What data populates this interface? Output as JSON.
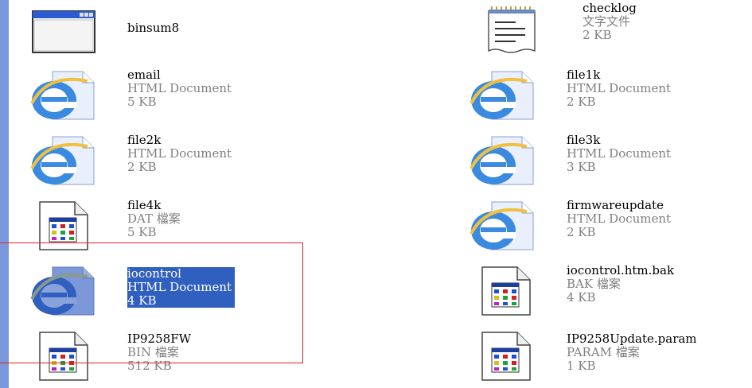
{
  "files": [
    {
      "name": "binsum8",
      "type": "",
      "size": "",
      "icon": "window-app-icon",
      "col": "left"
    },
    {
      "name": "checklog",
      "type": "文字文件",
      "size": "2 KB",
      "icon": "notepad-text-icon",
      "col": "right"
    },
    {
      "name": "email",
      "type": "HTML Document",
      "size": "5 KB",
      "icon": "ie-html-icon",
      "col": "left"
    },
    {
      "name": "file1k",
      "type": "HTML Document",
      "size": "2 KB",
      "icon": "ie-html-icon",
      "col": "right"
    },
    {
      "name": "file2k",
      "type": "HTML Document",
      "size": "2 KB",
      "icon": "ie-html-icon",
      "col": "left"
    },
    {
      "name": "file3k",
      "type": "HTML Document",
      "size": "3 KB",
      "icon": "ie-html-icon",
      "col": "right"
    },
    {
      "name": "file4k",
      "type": "DAT 檔案",
      "size": "5 KB",
      "icon": "generic-file-icon",
      "col": "left"
    },
    {
      "name": "firmwareupdate",
      "type": "HTML Document",
      "size": "2 KB",
      "icon": "ie-html-icon",
      "col": "right"
    },
    {
      "name": "iocontrol",
      "type": "HTML Document",
      "size": "4 KB",
      "icon": "ie-html-icon",
      "col": "left",
      "selected": true
    },
    {
      "name": "iocontrol.htm.bak",
      "type": "BAK 檔案",
      "size": "4 KB",
      "icon": "generic-file-icon",
      "col": "right"
    },
    {
      "name": "IP9258FW",
      "type": "BIN 檔案",
      "size": "512 KB",
      "icon": "generic-file-icon",
      "col": "left"
    },
    {
      "name": "IP9258Update.param",
      "type": "PARAM 檔案",
      "size": "1 KB",
      "icon": "generic-file-icon",
      "col": "right"
    }
  ],
  "colors": {
    "selection": "#2f5fbf",
    "annotation": "#e02020",
    "sidebar": "#7b98dc"
  }
}
